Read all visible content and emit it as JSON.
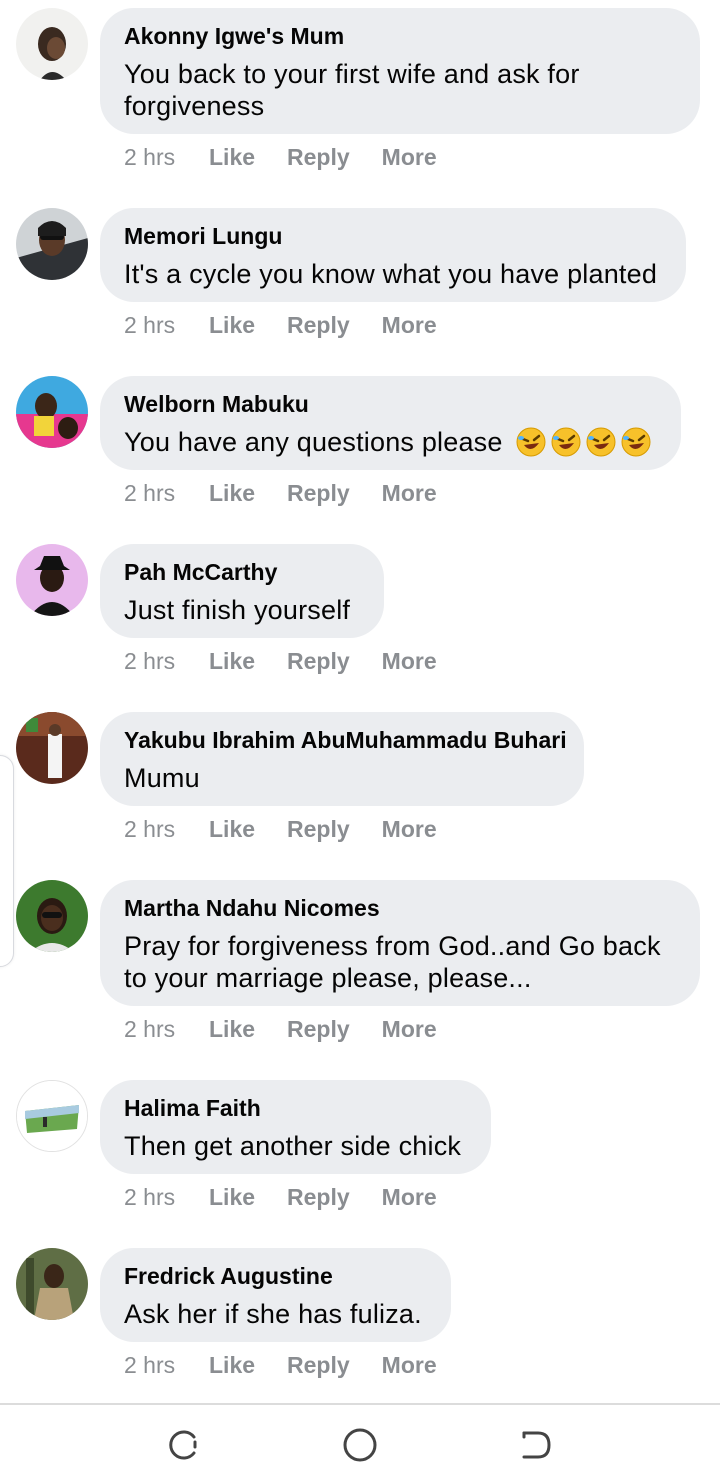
{
  "comments": [
    {
      "author": "Akonny Igwe's Mum",
      "text": "You back to your first wife and ask for forgiveness",
      "time": "2 hrs",
      "like": "Like",
      "reply": "Reply",
      "more": "More"
    },
    {
      "author": "Memori Lungu",
      "text": "It's a cycle you know what you have planted",
      "time": "2 hrs",
      "like": "Like",
      "reply": "Reply",
      "more": "More"
    },
    {
      "author": "Welborn Mabuku",
      "text": "You have any questions please",
      "emoji": "🤣🤣🤣🤣",
      "time": "2 hrs",
      "like": "Like",
      "reply": "Reply",
      "more": "More"
    },
    {
      "author": "Pah McCarthy",
      "text": "Just finish yourself",
      "time": "2 hrs",
      "like": "Like",
      "reply": "Reply",
      "more": "More"
    },
    {
      "author": "Yakubu Ibrahim AbuMuhammadu Buhari",
      "text": "Mumu",
      "time": "2 hrs",
      "like": "Like",
      "reply": "Reply",
      "more": "More"
    },
    {
      "author": "Martha Ndahu Nicomes",
      "text": "Pray for forgiveness from God..and Go back to your marriage please, please...",
      "time": "2 hrs",
      "like": "Like",
      "reply": "Reply",
      "more": "More"
    },
    {
      "author": "Halima Faith",
      "text": "Then get another side chick",
      "time": "2 hrs",
      "like": "Like",
      "reply": "Reply",
      "more": "More"
    },
    {
      "author": "Fredrick Augustine",
      "text": "Ask her if she has fuliza.",
      "time": "2 hrs",
      "like": "Like",
      "reply": "Reply",
      "more": "More"
    }
  ],
  "navbar": {
    "recents_icon": "recent-apps-icon",
    "home_icon": "home-icon",
    "back_icon": "back-icon"
  },
  "colors": {
    "bubble": "#ebedf0",
    "action_text": "#8a8d91",
    "primary_text": "#050505"
  }
}
